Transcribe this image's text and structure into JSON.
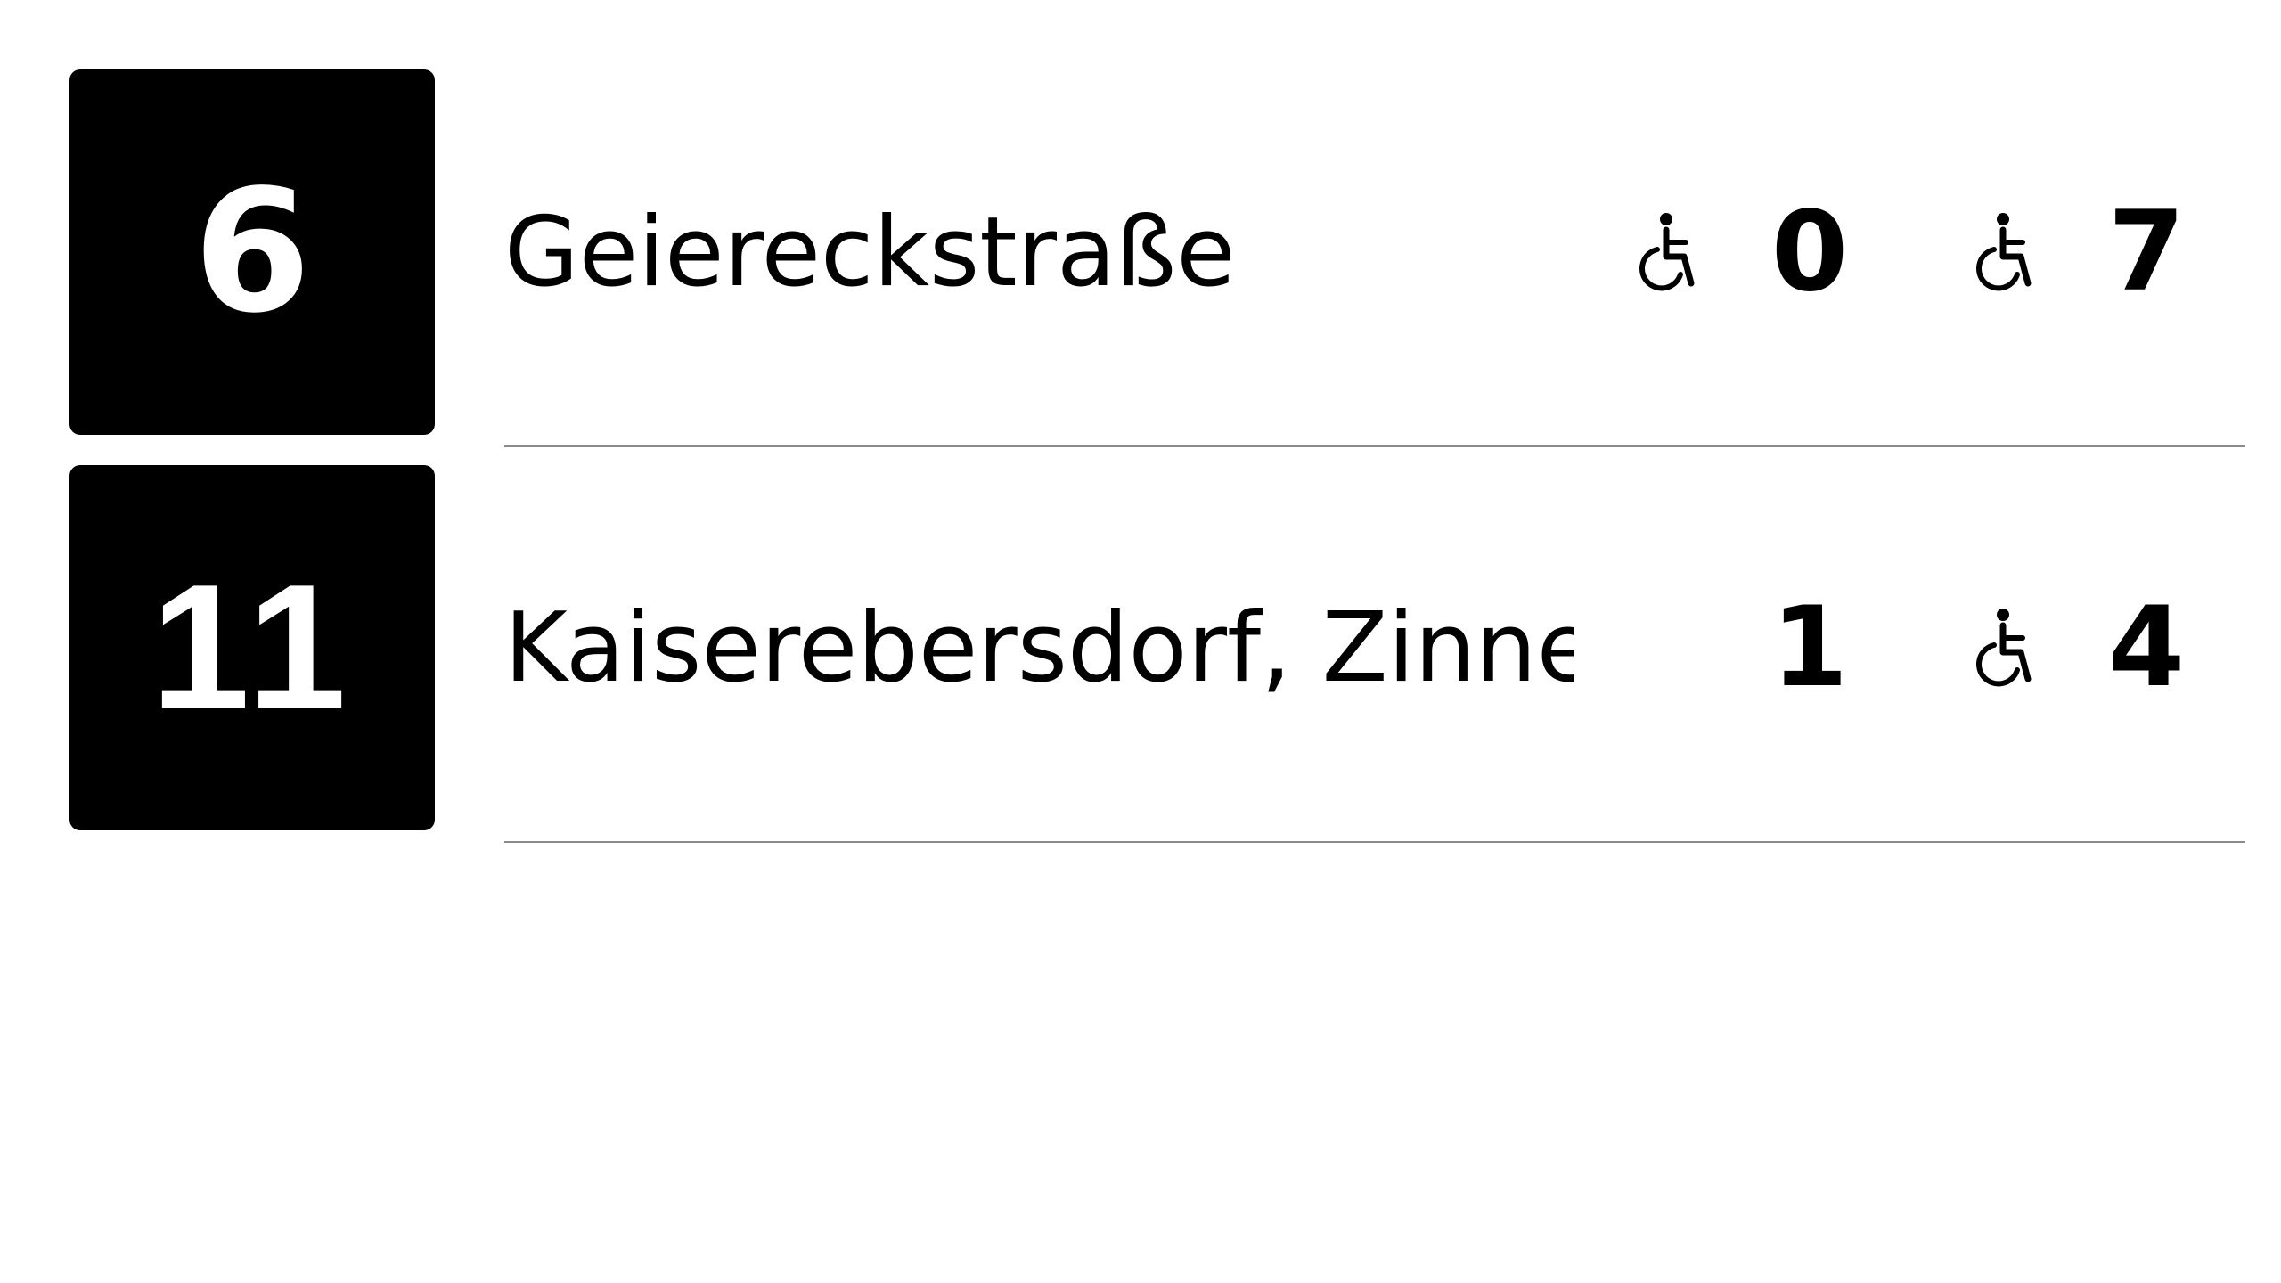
{
  "departures": [
    {
      "line": "6",
      "destination": "Geiereckstraße",
      "times": [
        {
          "minutes": "0",
          "accessible_icon": "wheelchair-icon",
          "accessible": true
        },
        {
          "minutes": "7",
          "accessible_icon": "wheelchair-icon",
          "accessible": true
        }
      ]
    },
    {
      "line": "11",
      "destination": "Kaiserebersdorf, Zinne...",
      "times": [
        {
          "minutes": "1",
          "accessible_icon": "wheelchair-icon",
          "accessible": false
        },
        {
          "minutes": "4",
          "accessible_icon": "wheelchair-icon",
          "accessible": true
        }
      ]
    }
  ],
  "colors": {
    "background": "#ffffff",
    "badge_background": "#000000",
    "badge_text": "#ffffff",
    "text": "#000000",
    "divider": "#8a8a8a"
  }
}
